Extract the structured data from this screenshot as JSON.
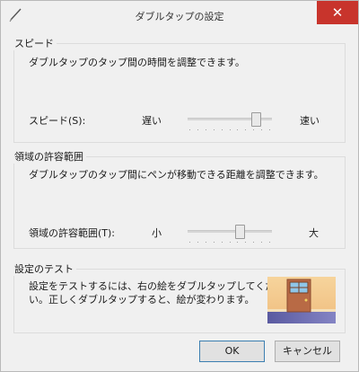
{
  "window": {
    "title": "ダブルタップの設定",
    "close_label": "✕"
  },
  "speed": {
    "group_label": "スピード",
    "description": "ダブルタップのタップ間の時間を調整できます。",
    "slider_label": "スピード(S):",
    "min_label": "遅い",
    "max_label": "速い",
    "value_fraction": 0.86
  },
  "tolerance": {
    "group_label": "領域の許容範囲",
    "description": "ダブルタップのタップ間にペンが移動できる距離を調整できます。",
    "slider_label": "領域の許容範囲(T):",
    "min_label": "小",
    "max_label": "大",
    "value_fraction": 0.64
  },
  "test": {
    "group_label": "設定のテスト",
    "description_line1": "設定をテストするには、右の絵をダブルタップしてくださ",
    "description_line2": "い。正しくダブルタップすると、絵が変わります。"
  },
  "buttons": {
    "ok": "OK",
    "cancel": "キャンセル"
  },
  "colors": {
    "close": "#c8342c",
    "wall": "#f3c890",
    "door": "#c0704a",
    "floor": "#6f6fae"
  },
  "icons": {
    "app": "pen-icon",
    "close": "close-icon",
    "test": "door-picture"
  }
}
